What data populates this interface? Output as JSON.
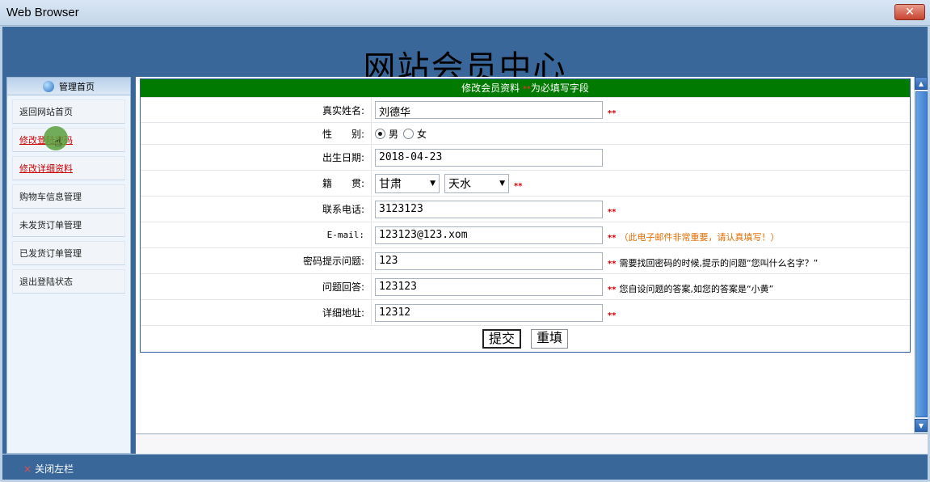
{
  "window": {
    "title": "Web Browser",
    "close": "✕"
  },
  "header": {
    "site_title": "网站会员中心"
  },
  "sidebar": {
    "heading": "管理首页",
    "items": [
      {
        "label": "返回网站首页"
      },
      {
        "label": "修改登陆密码"
      },
      {
        "label": "修改详细资料"
      },
      {
        "label": "购物车信息管理"
      },
      {
        "label": "未发货订单管理"
      },
      {
        "label": "已发货订单管理"
      },
      {
        "label": "退出登陆状态"
      }
    ]
  },
  "form": {
    "heading_main": "修改会员资料 ",
    "heading_req": "**",
    "heading_tail": "为必填写字段",
    "required_mark": "**",
    "fields": {
      "name": {
        "label": "真实姓名:",
        "value": "刘德华"
      },
      "gender": {
        "label": "性　　别:",
        "male": "男",
        "female": "女",
        "selected": "男"
      },
      "birthday": {
        "label": "出生日期:",
        "value": "2018-04-23"
      },
      "hometown": {
        "label": "籍　　贯:",
        "province": "甘肃",
        "city": "天水"
      },
      "phone": {
        "label": "联系电话:",
        "value": "3123123"
      },
      "email": {
        "label": "E-mail:",
        "value": "123123@123.xom",
        "hint": "（此电子邮件非常重要，请认真填写！）"
      },
      "question": {
        "label": "密码提示问题:",
        "value": "123",
        "hint": "需要找回密码的时候,提示的问题“您叫什么名字？”"
      },
      "answer": {
        "label": "问题回答:",
        "value": "123123",
        "hint": "您自设问题的答案,如您的答案是“小黄”"
      },
      "address": {
        "label": "详细地址:",
        "value": "12312"
      }
    },
    "submit_label": "提交",
    "reset_label": "重填"
  },
  "footer": {
    "close_left": "关闭左栏",
    "close_mark": "×"
  }
}
